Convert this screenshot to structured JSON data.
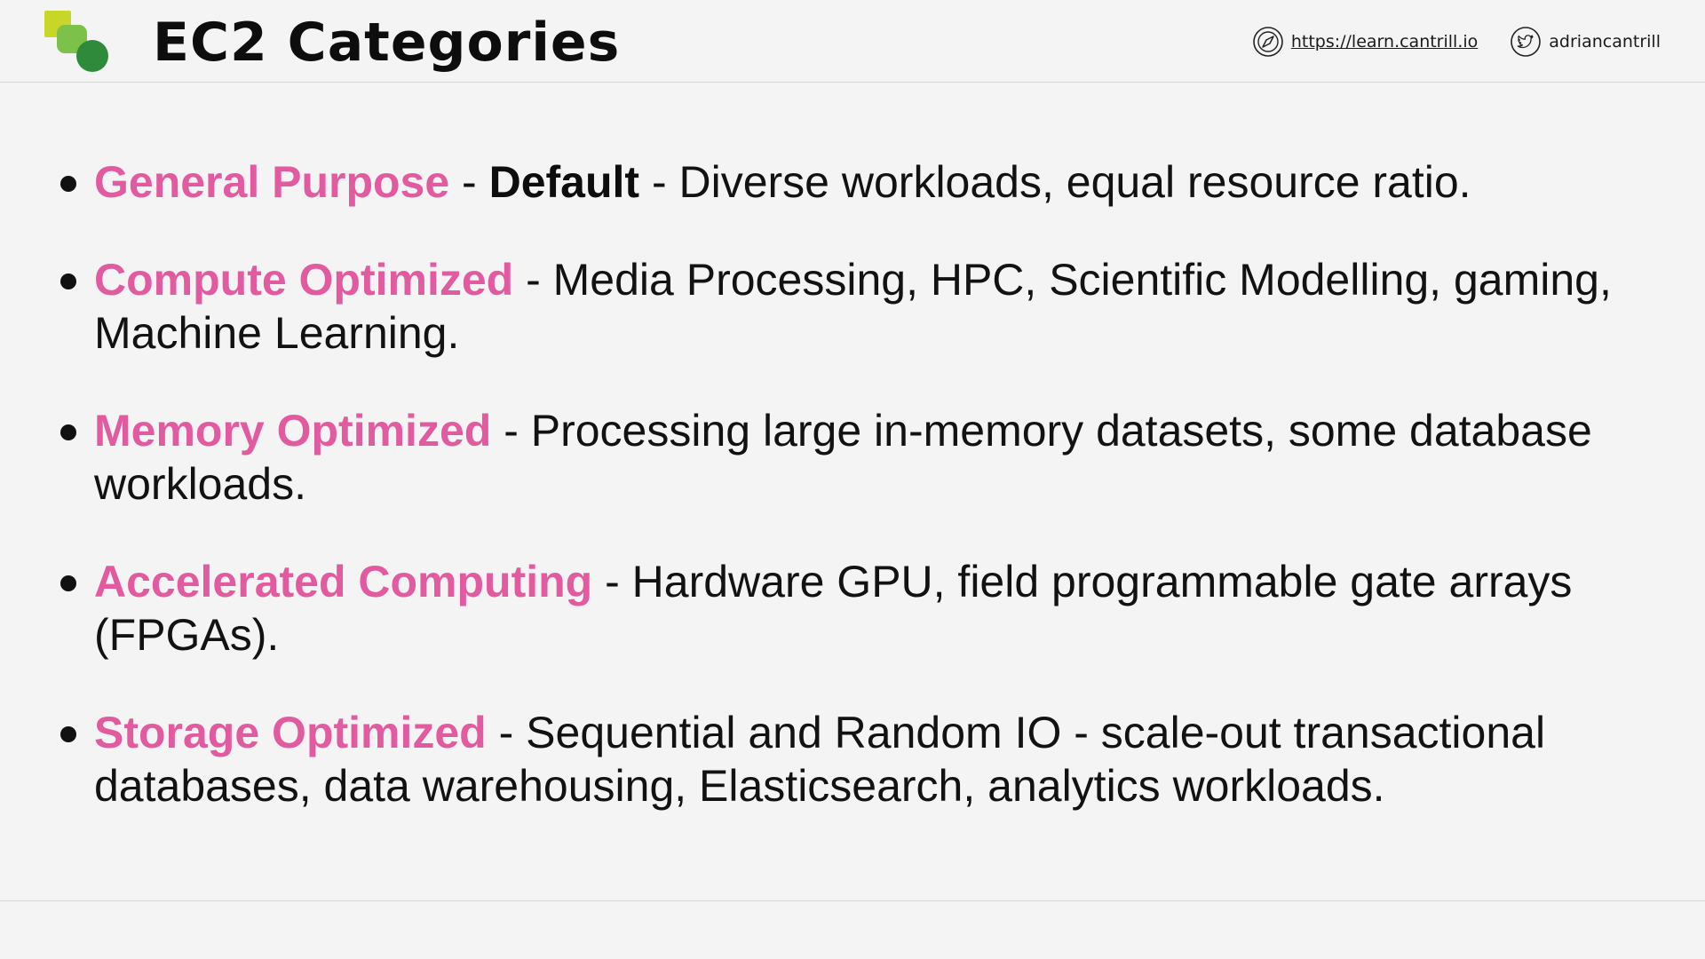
{
  "header": {
    "title": "EC2 Categories",
    "website": "https://learn.cantrill.io",
    "website_icon": "compass-icon",
    "twitter_handle": "adriancantrill",
    "twitter_icon": "twitter-bird-icon"
  },
  "logo": {
    "icon": "cantrill-logo-icon",
    "colors": [
      "#c8d62a",
      "#7cc24a",
      "#2f8a3c"
    ]
  },
  "colors": {
    "term": "#e25aa0",
    "text": "#121212",
    "background": "#f4f4f4"
  },
  "items": [
    {
      "term": "General Purpose",
      "sep1": " - ",
      "bold": "Default",
      "sep2": " - ",
      "desc": "Diverse workloads, equal resource ratio."
    },
    {
      "term": "Compute Optimized",
      "sep": " - ",
      "desc": "Media Processing, HPC, Scientific Modelling, gaming, Machine Learning."
    },
    {
      "term": "Memory Optimized",
      "sep": " - ",
      "desc": "Processing large in-memory datasets, some database workloads."
    },
    {
      "term": "Accelerated Computing",
      "sep": " - ",
      "desc": "Hardware GPU, field programmable gate arrays (FPGAs)."
    },
    {
      "term": "Storage Optimized",
      "sep": " - ",
      "desc": "Sequential and Random IO - scale-out transactional databases, data warehousing, Elasticsearch, analytics workloads."
    }
  ]
}
